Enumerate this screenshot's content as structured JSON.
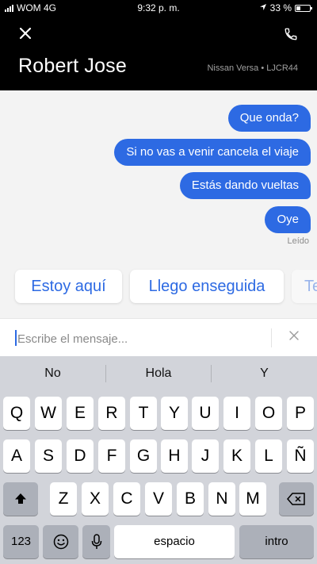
{
  "status_bar": {
    "carrier": "WOM 4G",
    "time": "9:32 p. m.",
    "battery": "33 %",
    "battery_level": 0.33
  },
  "header": {
    "driver_name": "Robert Jose",
    "vehicle": "Nissan Versa • LJCR44"
  },
  "messages": [
    {
      "text": "Que onda?"
    },
    {
      "text": "Si no vas a venir cancela el viaje"
    },
    {
      "text": "Estás dando vueltas"
    },
    {
      "text": "Oye"
    }
  ],
  "read_receipt": "Leído",
  "quick_replies": [
    "Estoy aquí",
    "Llego enseguida",
    "Te"
  ],
  "input": {
    "placeholder": "Escribe el mensaje..."
  },
  "keyboard": {
    "suggestions": [
      "No",
      "Hola",
      "Y"
    ],
    "row1": [
      "Q",
      "W",
      "E",
      "R",
      "T",
      "Y",
      "U",
      "I",
      "O",
      "P"
    ],
    "row2": [
      "A",
      "S",
      "D",
      "F",
      "G",
      "H",
      "J",
      "K",
      "L",
      "Ñ"
    ],
    "row3": [
      "Z",
      "X",
      "C",
      "V",
      "B",
      "N",
      "M"
    ],
    "numbers_key": "123",
    "space_key": "espacio",
    "return_key": "intro"
  },
  "colors": {
    "accent": "#2d6ae3",
    "header_bg": "#000000",
    "keyboard_bg": "#d2d4da"
  }
}
